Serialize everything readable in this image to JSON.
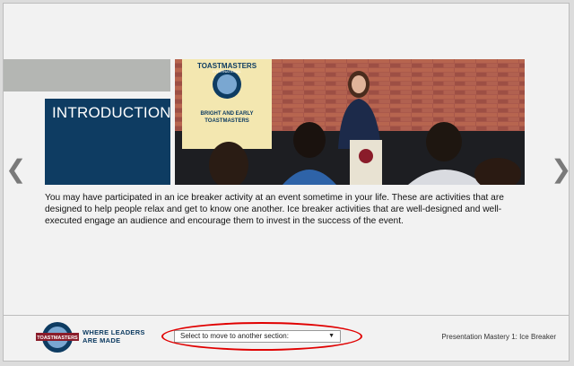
{
  "slide": {
    "heading": "INTRODUCTION",
    "paragraph": "You may have participated in an ice breaker activity at an event sometime in your life. These are activities that are designed to help people relax and get to know one another. Ice breaker activities that are well-designed and well-executed engage an audience and encourage them to invest in the success of the event.",
    "banner_title": "TOASTMASTERS",
    "banner_subtitle": "INTERNATIONAL",
    "banner_club_line1": "BRIGHT AND EARLY",
    "banner_club_line2": "TOASTMASTERS"
  },
  "nav": {
    "prev_icon": "chevron-left-icon",
    "next_icon": "chevron-right-icon",
    "prev_glyph": "❮",
    "next_glyph": "❯"
  },
  "footer": {
    "logo_text": "TOASTMASTERS",
    "tagline_line1": "WHERE LEADERS",
    "tagline_line2": "ARE MADE",
    "section_select_value": "Select to move to another section:",
    "course_title": "Presentation Mastery 1: Ice Breaker"
  },
  "colors": {
    "brand_navy": "#0e3c62",
    "highlight_red": "#e00000",
    "banner_cream": "#f3e7b0",
    "brick": "#a8574a"
  }
}
